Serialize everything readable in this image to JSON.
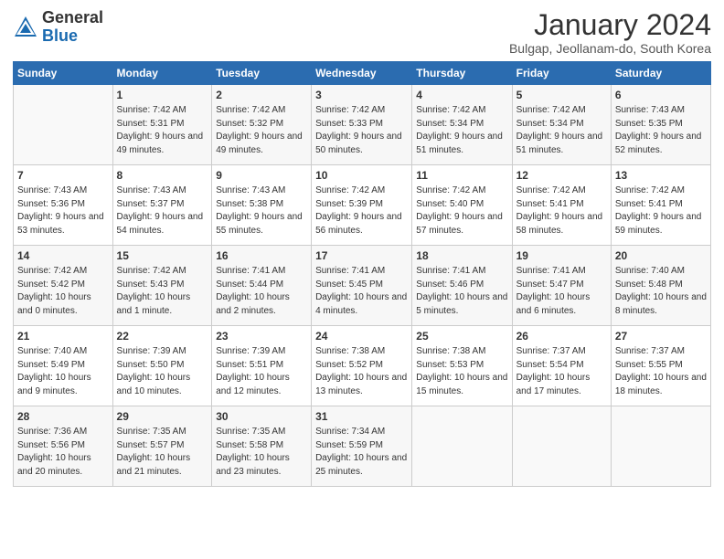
{
  "header": {
    "logo_general": "General",
    "logo_blue": "Blue",
    "title": "January 2024",
    "subtitle": "Bulgap, Jeollanam-do, South Korea"
  },
  "days_of_week": [
    "Sunday",
    "Monday",
    "Tuesday",
    "Wednesday",
    "Thursday",
    "Friday",
    "Saturday"
  ],
  "weeks": [
    [
      {
        "day": "",
        "sunrise": "",
        "sunset": "",
        "daylight": ""
      },
      {
        "day": "1",
        "sunrise": "Sunrise: 7:42 AM",
        "sunset": "Sunset: 5:31 PM",
        "daylight": "Daylight: 9 hours and 49 minutes."
      },
      {
        "day": "2",
        "sunrise": "Sunrise: 7:42 AM",
        "sunset": "Sunset: 5:32 PM",
        "daylight": "Daylight: 9 hours and 49 minutes."
      },
      {
        "day": "3",
        "sunrise": "Sunrise: 7:42 AM",
        "sunset": "Sunset: 5:33 PM",
        "daylight": "Daylight: 9 hours and 50 minutes."
      },
      {
        "day": "4",
        "sunrise": "Sunrise: 7:42 AM",
        "sunset": "Sunset: 5:34 PM",
        "daylight": "Daylight: 9 hours and 51 minutes."
      },
      {
        "day": "5",
        "sunrise": "Sunrise: 7:42 AM",
        "sunset": "Sunset: 5:34 PM",
        "daylight": "Daylight: 9 hours and 51 minutes."
      },
      {
        "day": "6",
        "sunrise": "Sunrise: 7:43 AM",
        "sunset": "Sunset: 5:35 PM",
        "daylight": "Daylight: 9 hours and 52 minutes."
      }
    ],
    [
      {
        "day": "7",
        "sunrise": "Sunrise: 7:43 AM",
        "sunset": "Sunset: 5:36 PM",
        "daylight": "Daylight: 9 hours and 53 minutes."
      },
      {
        "day": "8",
        "sunrise": "Sunrise: 7:43 AM",
        "sunset": "Sunset: 5:37 PM",
        "daylight": "Daylight: 9 hours and 54 minutes."
      },
      {
        "day": "9",
        "sunrise": "Sunrise: 7:43 AM",
        "sunset": "Sunset: 5:38 PM",
        "daylight": "Daylight: 9 hours and 55 minutes."
      },
      {
        "day": "10",
        "sunrise": "Sunrise: 7:42 AM",
        "sunset": "Sunset: 5:39 PM",
        "daylight": "Daylight: 9 hours and 56 minutes."
      },
      {
        "day": "11",
        "sunrise": "Sunrise: 7:42 AM",
        "sunset": "Sunset: 5:40 PM",
        "daylight": "Daylight: 9 hours and 57 minutes."
      },
      {
        "day": "12",
        "sunrise": "Sunrise: 7:42 AM",
        "sunset": "Sunset: 5:41 PM",
        "daylight": "Daylight: 9 hours and 58 minutes."
      },
      {
        "day": "13",
        "sunrise": "Sunrise: 7:42 AM",
        "sunset": "Sunset: 5:41 PM",
        "daylight": "Daylight: 9 hours and 59 minutes."
      }
    ],
    [
      {
        "day": "14",
        "sunrise": "Sunrise: 7:42 AM",
        "sunset": "Sunset: 5:42 PM",
        "daylight": "Daylight: 10 hours and 0 minutes."
      },
      {
        "day": "15",
        "sunrise": "Sunrise: 7:42 AM",
        "sunset": "Sunset: 5:43 PM",
        "daylight": "Daylight: 10 hours and 1 minute."
      },
      {
        "day": "16",
        "sunrise": "Sunrise: 7:41 AM",
        "sunset": "Sunset: 5:44 PM",
        "daylight": "Daylight: 10 hours and 2 minutes."
      },
      {
        "day": "17",
        "sunrise": "Sunrise: 7:41 AM",
        "sunset": "Sunset: 5:45 PM",
        "daylight": "Daylight: 10 hours and 4 minutes."
      },
      {
        "day": "18",
        "sunrise": "Sunrise: 7:41 AM",
        "sunset": "Sunset: 5:46 PM",
        "daylight": "Daylight: 10 hours and 5 minutes."
      },
      {
        "day": "19",
        "sunrise": "Sunrise: 7:41 AM",
        "sunset": "Sunset: 5:47 PM",
        "daylight": "Daylight: 10 hours and 6 minutes."
      },
      {
        "day": "20",
        "sunrise": "Sunrise: 7:40 AM",
        "sunset": "Sunset: 5:48 PM",
        "daylight": "Daylight: 10 hours and 8 minutes."
      }
    ],
    [
      {
        "day": "21",
        "sunrise": "Sunrise: 7:40 AM",
        "sunset": "Sunset: 5:49 PM",
        "daylight": "Daylight: 10 hours and 9 minutes."
      },
      {
        "day": "22",
        "sunrise": "Sunrise: 7:39 AM",
        "sunset": "Sunset: 5:50 PM",
        "daylight": "Daylight: 10 hours and 10 minutes."
      },
      {
        "day": "23",
        "sunrise": "Sunrise: 7:39 AM",
        "sunset": "Sunset: 5:51 PM",
        "daylight": "Daylight: 10 hours and 12 minutes."
      },
      {
        "day": "24",
        "sunrise": "Sunrise: 7:38 AM",
        "sunset": "Sunset: 5:52 PM",
        "daylight": "Daylight: 10 hours and 13 minutes."
      },
      {
        "day": "25",
        "sunrise": "Sunrise: 7:38 AM",
        "sunset": "Sunset: 5:53 PM",
        "daylight": "Daylight: 10 hours and 15 minutes."
      },
      {
        "day": "26",
        "sunrise": "Sunrise: 7:37 AM",
        "sunset": "Sunset: 5:54 PM",
        "daylight": "Daylight: 10 hours and 17 minutes."
      },
      {
        "day": "27",
        "sunrise": "Sunrise: 7:37 AM",
        "sunset": "Sunset: 5:55 PM",
        "daylight": "Daylight: 10 hours and 18 minutes."
      }
    ],
    [
      {
        "day": "28",
        "sunrise": "Sunrise: 7:36 AM",
        "sunset": "Sunset: 5:56 PM",
        "daylight": "Daylight: 10 hours and 20 minutes."
      },
      {
        "day": "29",
        "sunrise": "Sunrise: 7:35 AM",
        "sunset": "Sunset: 5:57 PM",
        "daylight": "Daylight: 10 hours and 21 minutes."
      },
      {
        "day": "30",
        "sunrise": "Sunrise: 7:35 AM",
        "sunset": "Sunset: 5:58 PM",
        "daylight": "Daylight: 10 hours and 23 minutes."
      },
      {
        "day": "31",
        "sunrise": "Sunrise: 7:34 AM",
        "sunset": "Sunset: 5:59 PM",
        "daylight": "Daylight: 10 hours and 25 minutes."
      },
      {
        "day": "",
        "sunrise": "",
        "sunset": "",
        "daylight": ""
      },
      {
        "day": "",
        "sunrise": "",
        "sunset": "",
        "daylight": ""
      },
      {
        "day": "",
        "sunrise": "",
        "sunset": "",
        "daylight": ""
      }
    ]
  ]
}
